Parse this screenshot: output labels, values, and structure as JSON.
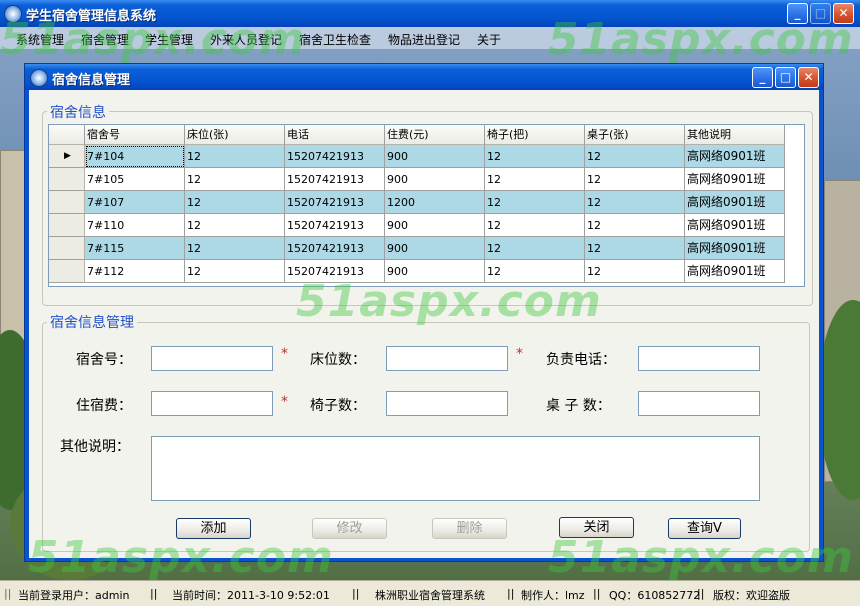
{
  "app": {
    "title": "学生宿舍管理信息系统"
  },
  "menu": [
    "系统管理",
    "宿舍管理",
    "学生管理",
    "外来人员登记",
    "宿舍卫生检查",
    "物品进出登记",
    "关于"
  ],
  "watermark": "51aspx.com",
  "dialog": {
    "title": "宿舍信息管理",
    "grid_group_title": "宿舍信息",
    "columns": [
      "宿舍号",
      "床位(张)",
      "电话",
      "住费(元)",
      "椅子(把)",
      "桌子(张)",
      "其他说明"
    ],
    "rows": [
      [
        "7#104",
        "12",
        "15207421913",
        "900",
        "12",
        "12",
        "高网络0901班"
      ],
      [
        "7#105",
        "12",
        "15207421913",
        "900",
        "12",
        "12",
        "高网络0901班"
      ],
      [
        "7#107",
        "12",
        "15207421913",
        "1200",
        "12",
        "12",
        "高网络0901班"
      ],
      [
        "7#110",
        "12",
        "15207421913",
        "900",
        "12",
        "12",
        "高网络0901班"
      ],
      [
        "7#115",
        "12",
        "15207421913",
        "900",
        "12",
        "12",
        "高网络0901班"
      ],
      [
        "7#112",
        "12",
        "15207421913",
        "900",
        "12",
        "12",
        "高网络0901班"
      ]
    ],
    "form_group_title": "宿舍信息管理",
    "fields": {
      "room_no_label": "宿舍号：",
      "beds_label": "床位数：",
      "phone_label": "负责电话：",
      "fee_label": "住宿费：",
      "chairs_label": "椅子数：",
      "desks_label": "桌 子 数：",
      "notes_label": "其他说明：",
      "required_mark": "*"
    },
    "buttons": {
      "add": "添加",
      "edit": "修改",
      "delete": "删除",
      "close": "关闭",
      "query": "查询V"
    }
  },
  "status": {
    "user": "当前登录用户：admin",
    "time": "当前时间：2011-3-10 9:52:01",
    "system": "株洲职业宿舍管理系统",
    "author": "制作人：lmz",
    "qq": "QQ：610852772",
    "copyright": "版权：欢迎盗版",
    "separator": "||"
  }
}
